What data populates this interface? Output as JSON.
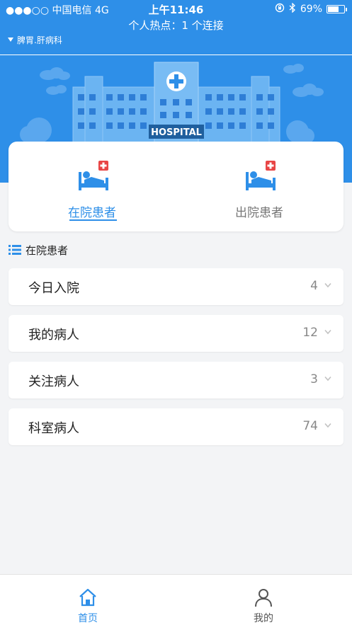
{
  "status_bar": {
    "carrier": "●●●○○ 中国电信   4G",
    "time": "上午11:46",
    "battery": "69%",
    "battery_level": 0.69
  },
  "hotspot": {
    "text": "个人热点：1 个连接"
  },
  "nav": {
    "department": "脾胃.肝病科"
  },
  "header": {
    "hospital_sign": "HOSPITAL"
  },
  "tabs": [
    {
      "label": "在院患者",
      "active": true
    },
    {
      "label": "出院患者",
      "active": false
    }
  ],
  "section": {
    "title": "在院患者"
  },
  "list": [
    {
      "label": "今日入院",
      "count": "4"
    },
    {
      "label": "我的病人",
      "count": "12"
    },
    {
      "label": "关注病人",
      "count": "3"
    },
    {
      "label": "科室病人",
      "count": "74"
    }
  ],
  "bottom_nav": [
    {
      "label": "首页",
      "active": true
    },
    {
      "label": "我的",
      "active": false
    }
  ],
  "colors": {
    "accent": "#2e8fe8",
    "cross": "#e84545"
  }
}
